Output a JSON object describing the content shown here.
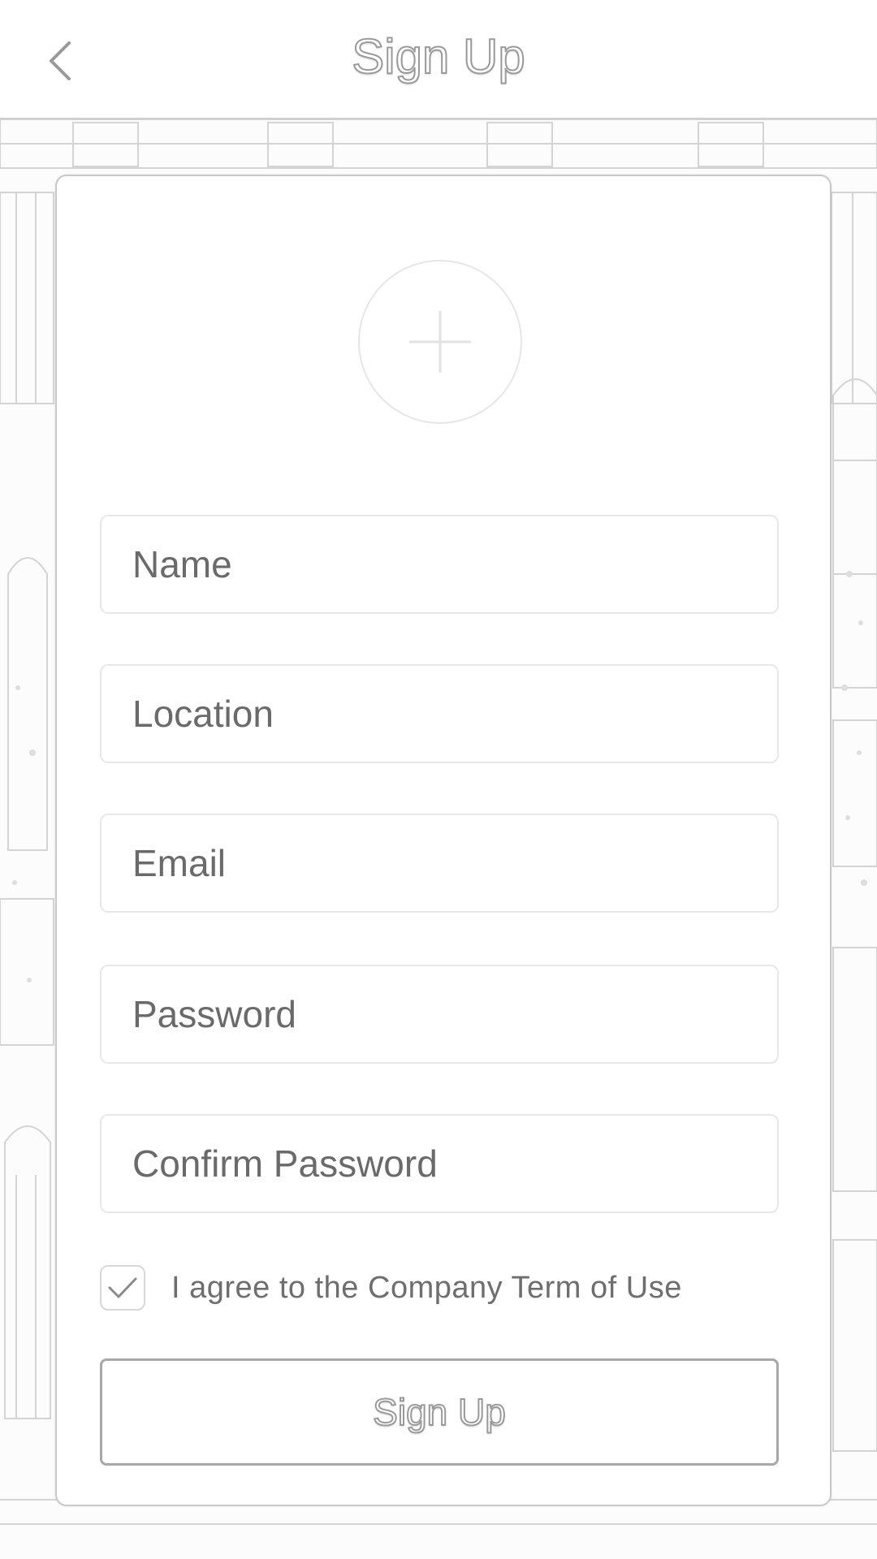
{
  "header": {
    "title": "Sign Up",
    "back_icon": "chevron-left-icon"
  },
  "avatar": {
    "icon": "plus-icon"
  },
  "form": {
    "fields": [
      {
        "placeholder": "Name",
        "value": ""
      },
      {
        "placeholder": "Location",
        "value": ""
      },
      {
        "placeholder": "Email",
        "value": ""
      },
      {
        "placeholder": "Password",
        "value": ""
      },
      {
        "placeholder": "Confirm Password",
        "value": ""
      }
    ],
    "agree": {
      "checked": true,
      "prefix": "I agree to the",
      "link": "Company Term of Use"
    },
    "submit_label": "Sign Up"
  },
  "colors": {
    "border": "#e8e8e8",
    "text": "#6a6a6a",
    "button_border": "#a8a8a8"
  }
}
